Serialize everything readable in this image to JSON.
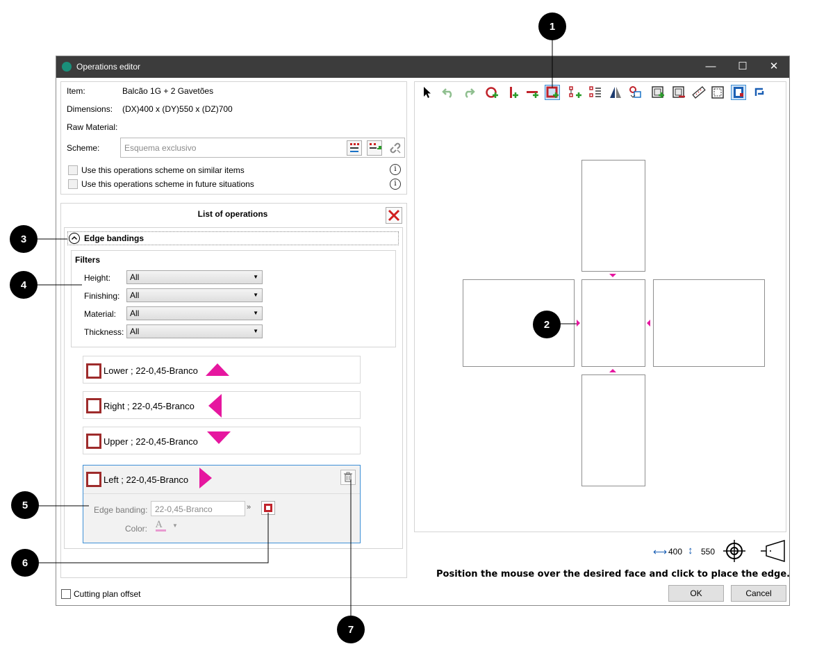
{
  "window": {
    "title": "Operations editor",
    "minimize": "—",
    "maximize": "☐",
    "close": "✕"
  },
  "item_info": {
    "item_label": "Item:",
    "item_value": "Balcão 1G + 2 Gavetões",
    "dimensions_label": "Dimensions:",
    "dimensions_value": "(DX)400 x (DY)550 x (DZ)700",
    "raw_material_label": "Raw Material:",
    "scheme_label": "Scheme:",
    "scheme_placeholder": "Esquema exclusivo",
    "similar_label": "Use this operations scheme on similar items",
    "future_label": "Use this operations scheme in future situations"
  },
  "operations": {
    "title": "List of operations",
    "section_label": "Edge bandings",
    "filters_label": "Filters",
    "filters": [
      {
        "label": "Height:",
        "value": "All"
      },
      {
        "label": "Finishing:",
        "value": "All"
      },
      {
        "label": "Material:",
        "value": "All"
      },
      {
        "label": "Thickness:",
        "value": "All"
      }
    ],
    "bandings": [
      {
        "label": "Lower ; 22-0,45-Branco",
        "direction": "up"
      },
      {
        "label": "Right ; 22-0,45-Branco",
        "direction": "left"
      },
      {
        "label": "Upper ; 22-0,45-Branco",
        "direction": "down"
      },
      {
        "label": "Left ; 22-0,45-Branco",
        "direction": "right"
      }
    ],
    "edit_edge_label": "Edge banding:",
    "edit_edge_value": "22-0,45-Branco",
    "edit_color_label": "Color:",
    "edit_color_glyph": "A"
  },
  "footer": {
    "cutting_offset_label": "Cutting plan offset",
    "dim_x": "400",
    "dim_y": "550",
    "hint": "Position the mouse over the desired face and click to place the edge.",
    "ok": "OK",
    "cancel": "Cancel"
  },
  "callouts": [
    "1",
    "2",
    "3",
    "4",
    "5",
    "6",
    "7"
  ],
  "colors": {
    "accent_magenta": "#e6179f",
    "edge_red": "#9e2b2b",
    "titlebar": "#3c3c3c"
  }
}
